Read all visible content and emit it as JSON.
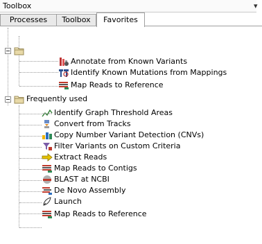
{
  "header": {
    "title": "Toolbox",
    "menu_glyph": "▾"
  },
  "tabs": [
    {
      "label": "Processes",
      "active": false
    },
    {
      "label": "Toolbox",
      "active": false
    },
    {
      "label": "Favorites",
      "active": true
    }
  ],
  "tree": {
    "group1": {
      "label": "",
      "items": [
        {
          "label": "Annotate from Known Variants",
          "icon": "annotate-variants-icon"
        },
        {
          "label": "Identify Known Mutations from Mappings",
          "icon": "identify-mutations-icon"
        },
        {
          "label": "Map Reads to Reference",
          "icon": "map-reads-icon"
        }
      ]
    },
    "group2": {
      "label": "Frequently used",
      "items": [
        {
          "label": "Identify Graph Threshold Areas",
          "icon": "graph-threshold-icon"
        },
        {
          "label": "Convert from Tracks",
          "icon": "convert-tracks-icon"
        },
        {
          "label": "Copy Number Variant Detection (CNVs)",
          "icon": "cnv-detection-icon"
        },
        {
          "label": "Filter Variants on Custom Criteria",
          "icon": "filter-variants-icon"
        },
        {
          "label": "Extract Reads",
          "icon": "extract-reads-icon"
        },
        {
          "label": "Map Reads to Contigs",
          "icon": "map-reads-icon"
        },
        {
          "label": "BLAST at NCBI",
          "icon": "blast-icon"
        },
        {
          "label": "De Novo Assembly",
          "icon": "de-novo-icon"
        },
        {
          "label": "Launch",
          "icon": "launch-icon"
        },
        {
          "label": "Map Reads to Reference",
          "icon": "map-reads-icon"
        }
      ]
    }
  },
  "colors": {
    "folder": "#e8d9a8",
    "tab_active": "#ffffff",
    "tab_inactive": "#e9e9e9"
  }
}
